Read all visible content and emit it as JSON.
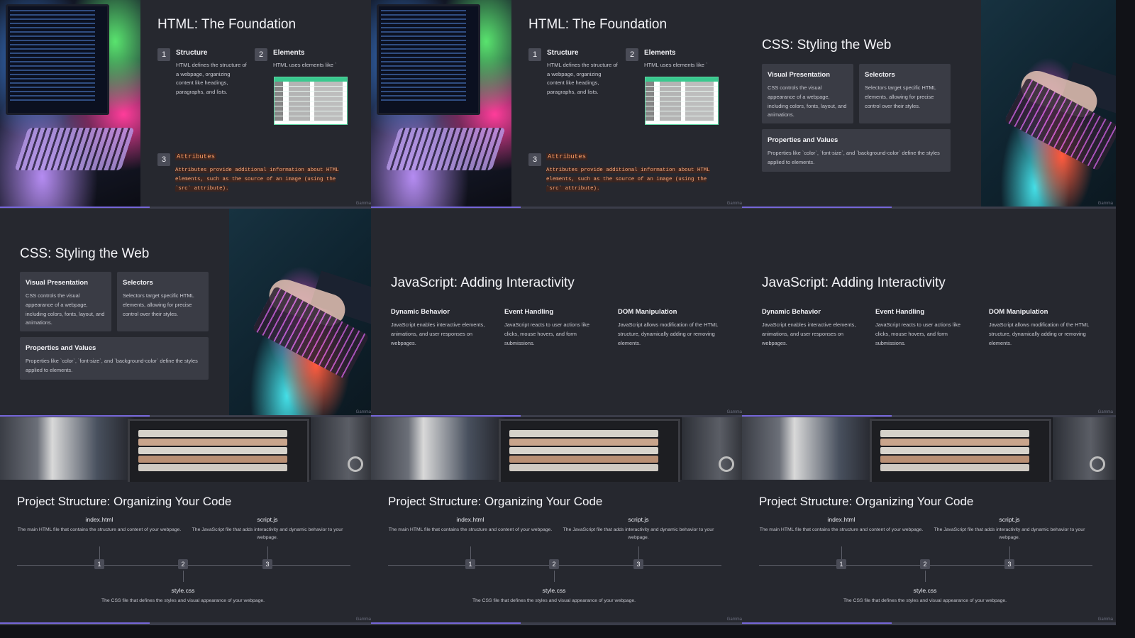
{
  "watermark": "Gamma",
  "html_slide": {
    "title": "HTML: The Foundation",
    "items": [
      {
        "num": "1",
        "title": "Structure",
        "body": "HTML defines the structure of a webpage, organizing content like headings, paragraphs, and lists."
      },
      {
        "num": "2",
        "title": "Elements",
        "body": "HTML uses elements like `"
      },
      {
        "num": "3",
        "title": "Attributes",
        "body": "Attributes provide additional information about HTML elements, such as the source of an image (using the `src` attribute)."
      }
    ]
  },
  "css_slide": {
    "title": "CSS: Styling the Web",
    "cards": [
      {
        "title": "Visual Presentation",
        "body": "CSS controls the visual appearance of a webpage, including colors, fonts, layout, and animations."
      },
      {
        "title": "Selectors",
        "body": "Selectors target specific HTML elements, allowing for precise control over their styles."
      },
      {
        "title": "Properties and Values",
        "body": "Properties like `color`, `font-size`, and `background-color` define the styles applied to elements."
      }
    ]
  },
  "js_slide": {
    "title": "JavaScript: Adding Interactivity",
    "columns": [
      {
        "title": "Dynamic Behavior",
        "body": "JavaScript enables interactive elements, animations, and user responses on webpages."
      },
      {
        "title": "Event Handling",
        "body": "JavaScript reacts to user actions like clicks, mouse hovers, and form submissions."
      },
      {
        "title": "DOM Manipulation",
        "body": "JavaScript allows modification of the HTML structure, dynamically adding or removing elements."
      }
    ]
  },
  "project_slide": {
    "title": "Project Structure: Organizing Your Code",
    "files": [
      {
        "num": "1",
        "name": "index.html",
        "desc": "The main HTML file that contains the structure and content of your webpage."
      },
      {
        "num": "2",
        "name": "style.css",
        "desc": "The CSS file that defines the styles and visual appearance of your webpage."
      },
      {
        "num": "3",
        "name": "script.js",
        "desc": "The JavaScript file that adds interactivity and dynamic behavior to your webpage."
      }
    ]
  }
}
